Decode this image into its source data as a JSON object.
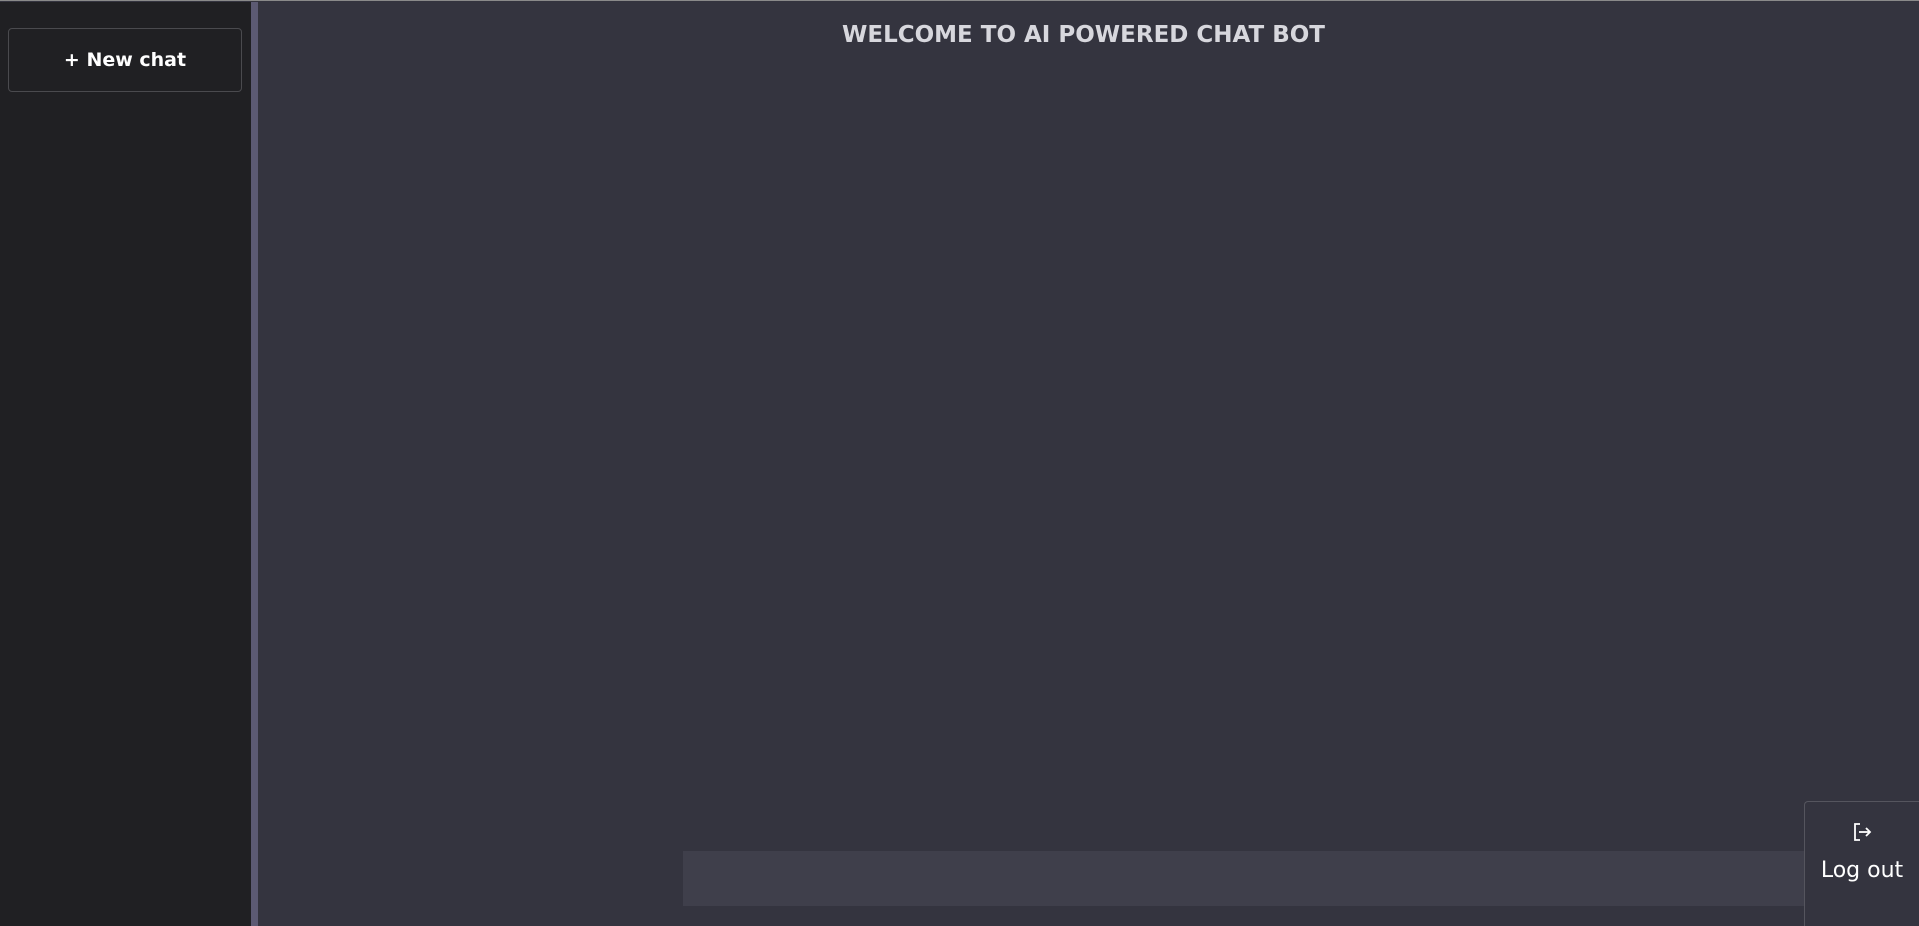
{
  "sidebar": {
    "new_chat_label": "+ New chat"
  },
  "main": {
    "title": "WELCOME TO AI POWERED CHAT BOT",
    "input": {
      "value": "",
      "placeholder": ""
    },
    "send_icon": "arrow-right-icon"
  },
  "logout": {
    "label": "Log out",
    "icon": "logout-icon"
  },
  "colors": {
    "sidebar_bg": "#202023",
    "main_bg": "#34343f",
    "divider": "#5c5a73",
    "input_bg": "#3f3f4b",
    "title_text": "#d7d7dd"
  }
}
